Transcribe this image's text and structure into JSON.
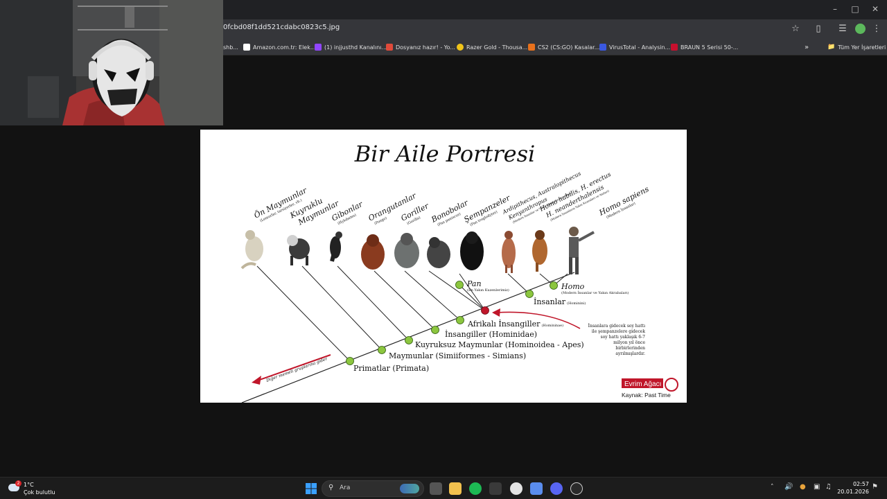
{
  "browser": {
    "url": "0fcbd08f1dd521cdabc0823c5.jpg",
    "bookmarks": [
      {
        "label": "shb..."
      },
      {
        "label": "Amazon.com.tr: Elek..."
      },
      {
        "label": "(1) injjusthd Kanalını..."
      },
      {
        "label": "Dosyanız hazır! - Yo..."
      },
      {
        "label": "Razer Gold - Thousa..."
      },
      {
        "label": "CS2 (CS:GO) Kasalar..."
      },
      {
        "label": "VirusTotal - Analysin..."
      },
      {
        "label": "BRAUN 5 Serisi 50-..."
      }
    ],
    "all_bookmarks": "Tüm Yer İşaretleri",
    "more_icon": "chevron-double-right-icon"
  },
  "figure": {
    "title": "Bir Aile Portresi",
    "species": [
      {
        "name": "Ön Maymunlar",
        "sub": "(Lemurlar, tarsiyerler, vb.)"
      },
      {
        "name": "Kuyruklu",
        "name2": "Maymunlar"
      },
      {
        "name": "Gibonlar",
        "sub": "(Hylobates)"
      },
      {
        "name": "Orangutanlar",
        "sub": "(Pongo)"
      },
      {
        "name": "Goriller",
        "sub": "(Gorilla)"
      },
      {
        "name": "Bonobolar",
        "sub": "(Pan paniscus)"
      },
      {
        "name": "Şempanzeler",
        "sub": "(Pan troglodytes)"
      },
      {
        "name": "Ardipithecus, Australopithecus",
        "name2": "Kenyanthropus",
        "sub": "(Modern İnsanlar ve Yakın Akrabalarının Atası)"
      },
      {
        "name": "Homo habilis, H. erectus",
        "name2": "H. neanderthalensis",
        "sub": "(Modern İnsanların Yakın Kuzenleri ve Ataları)"
      },
      {
        "name": "Homo sapiens",
        "sub": "(Modern İnsanlar)"
      }
    ],
    "nodes": {
      "pan": "Pan",
      "pan_sub": "(En Yakın Kuzenlerimiz)",
      "homo": "Homo",
      "homo_sub": "(Modern İnsanlar ve Yakın Akrabaları)",
      "insanlar": "İnsanlar",
      "insanlar_sub": "(Hominini)",
      "afrikali": "Afrikalı İnsangiller",
      "afrikali_sub": "(Homininae)",
      "insangiller": "İnsangiller (Hominidae)",
      "kuyruksuz": "Kuyruksuz Maymunlar (Hominoidea - Apes)",
      "maymunlar": "Maymunlar (Simiiformes - Simians)",
      "primatlar": "Primatlar (Primata)",
      "diger": "Diğer memeli gruplarına gider"
    },
    "note_lines": [
      "İnsanlara gidecek soy hattı",
      "ile şempanzelere gidecek",
      "soy hattı yaklaşık 6-7",
      "milyon yıl önce",
      "birbirlerinden",
      "ayrılmışlardır."
    ],
    "brand": "Evrim Ağacı",
    "source": "Kaynak: Past Time",
    "colors": {
      "node": "#8cc63f",
      "split_node": "#c0162a",
      "arrow": "#c0162a"
    }
  },
  "taskbar": {
    "weather_temp": "1°C",
    "weather_desc": "Çok bulutlu",
    "weather_badge": "2",
    "search_placeholder": "Ara",
    "time": "02:57",
    "date": "20.01.2026"
  }
}
